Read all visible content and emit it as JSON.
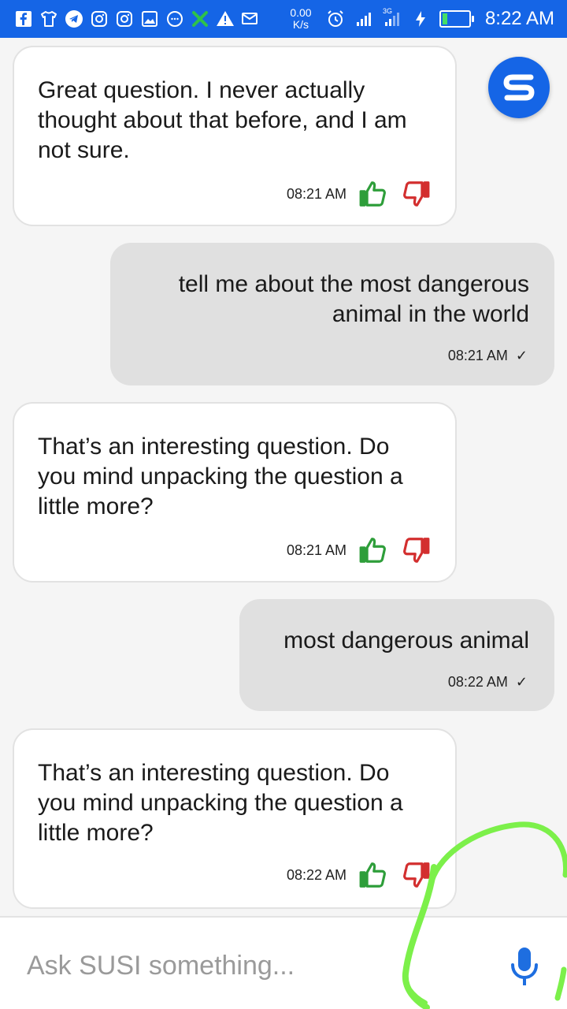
{
  "status_bar": {
    "net_speed_value": "0.00",
    "net_speed_unit": "K/s",
    "time": "8:22 AM",
    "network": "3G",
    "notification_icons": [
      "facebook-icon",
      "shirt-icon",
      "telegram-icon",
      "instagram-icon",
      "instagram-icon",
      "gallery-icon",
      "chat-bubble-icon",
      "x-icon",
      "warning-icon",
      "mail-icon"
    ]
  },
  "messages": [
    {
      "sender": "bot",
      "text": "Great question. I never actually thought about that before, and I am not sure.",
      "time": "08:21 AM"
    },
    {
      "sender": "user",
      "text": "tell me about the most dangerous animal in the world",
      "time": "08:21 AM",
      "status": "✓"
    },
    {
      "sender": "bot",
      "text": "That’s an interesting question. Do you mind unpacking the question a little more?",
      "time": "08:21 AM"
    },
    {
      "sender": "user",
      "text": "most dangerous animal",
      "time": "08:22 AM",
      "status": "✓"
    },
    {
      "sender": "bot",
      "text": "That’s an interesting question. Do you mind unpacking the question a little more?",
      "time": "08:22 AM"
    }
  ],
  "input": {
    "placeholder": "Ask SUSI something...",
    "value": ""
  },
  "colors": {
    "accent": "#1565e6",
    "thumb_up": "#2e9e3a",
    "thumb_down": "#d32f2f",
    "mic": "#1e6ee0",
    "annotation": "#7cf04a"
  }
}
